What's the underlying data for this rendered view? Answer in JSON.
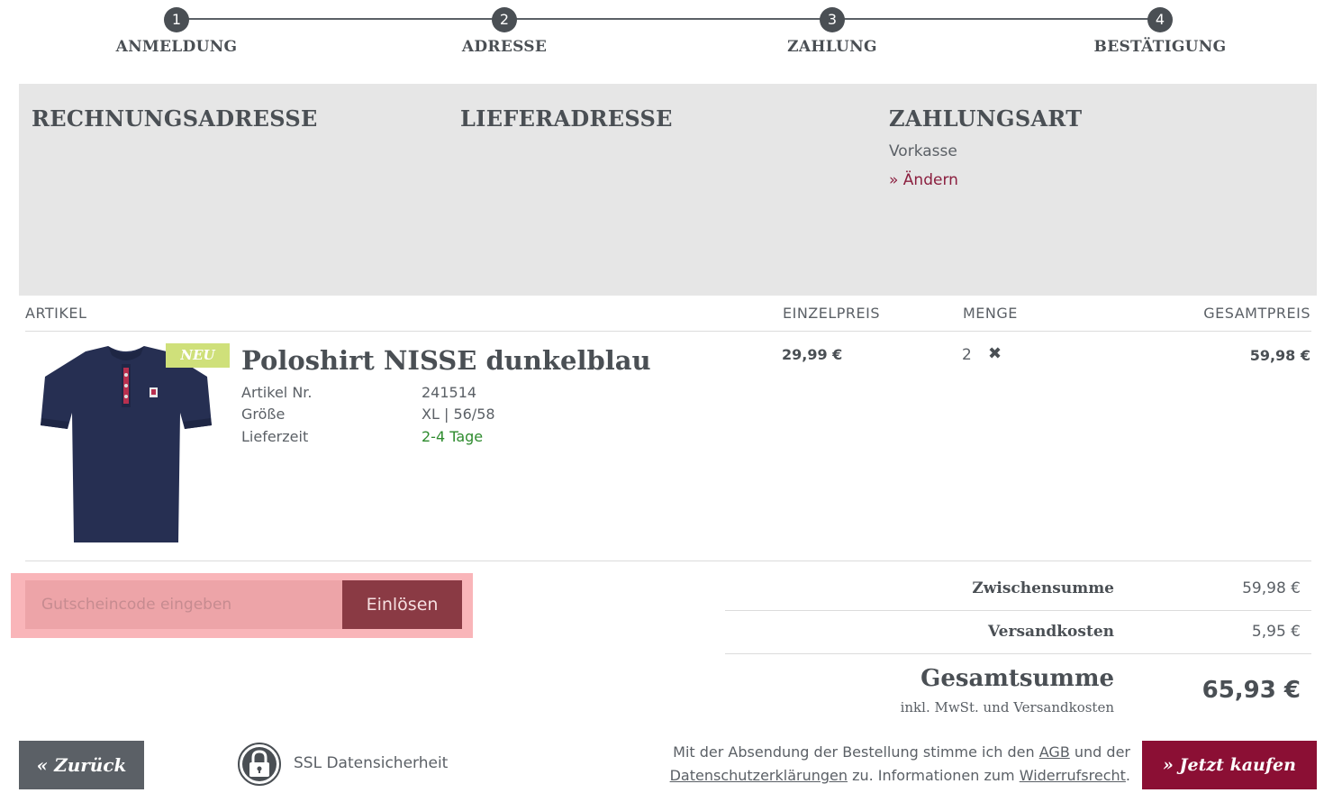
{
  "stepper": {
    "steps": [
      {
        "number": "1",
        "label": "ANMELDUNG"
      },
      {
        "number": "2",
        "label": "ADRESSE"
      },
      {
        "number": "3",
        "label": "ZAHLUNG"
      },
      {
        "number": "4",
        "label": "BESTÄTIGUNG"
      }
    ]
  },
  "panel": {
    "billing_title": "RECHNUNGSADRESSE",
    "shipping_title": "LIEFERADRESSE",
    "payment_title": "ZAHLUNGSART",
    "payment_method": "Vorkasse",
    "change_link": "» Ändern"
  },
  "table": {
    "headers": {
      "item": "ARTIKEL",
      "unit_price": "EINZELPREIS",
      "quantity": "MENGE",
      "total_price": "GESAMTPREIS"
    }
  },
  "product": {
    "badge": "NEU",
    "title": "Poloshirt NISSE dunkelblau",
    "attributes": [
      {
        "key": "Artikel Nr.",
        "value": "241514"
      },
      {
        "key": "Größe",
        "value": "XL | 56/58"
      },
      {
        "key": "Lieferzeit",
        "value": "2-4 Tage"
      }
    ],
    "unit_price": "29,99 €",
    "quantity": "2",
    "remove_symbol": "✖",
    "total_price": "59,98 €"
  },
  "voucher": {
    "placeholder": "Gutscheincode eingeben",
    "value": "",
    "button_label": "Einlösen"
  },
  "totals": {
    "subtotal_label": "Zwischensumme",
    "subtotal_value": "59,98 €",
    "shipping_label": "Versandkosten",
    "shipping_value": "5,95 €",
    "grand_total_label": "Gesamtsumme",
    "grand_total_value": "65,93 €",
    "grand_total_note": "inkl. MwSt. und Versandkosten"
  },
  "footer": {
    "back_label": "« Zurück",
    "ssl_label": "SSL Datensicherheit",
    "legal_part1": "Mit der Absendung der Bestellung stimme ich den",
    "legal_link_agb": "AGB",
    "legal_part2": "und der",
    "legal_link_privacy": "Datenschutzerklärungen",
    "legal_part3": "zu. Informationen zum",
    "legal_link_withdrawal": "Widerrufsrecht",
    "legal_part4": ".",
    "buy_label": "» Jetzt kaufen"
  },
  "colors": {
    "accent": "#8b0f34",
    "link": "#8b1f3f",
    "badge": "#cfe07a",
    "delivery_green": "#2e8b2e",
    "panel_bg": "#e6e6e6"
  },
  "icons": {
    "remove": "close-icon",
    "ssl": "lock-icon"
  }
}
